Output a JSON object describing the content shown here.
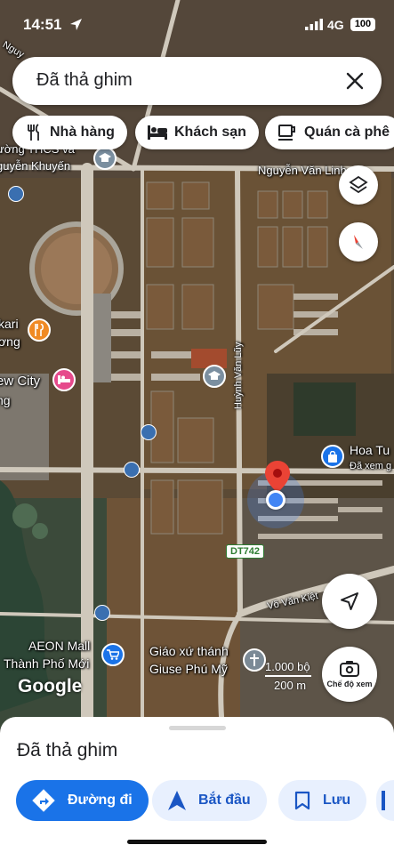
{
  "status_bar": {
    "time": "14:51",
    "network": "4G",
    "battery": "100"
  },
  "search": {
    "query": "Đã thả ghim"
  },
  "chips": [
    {
      "label": "Nhà hàng",
      "icon": "fork-knife-icon"
    },
    {
      "label": "Khách sạn",
      "icon": "bed-icon"
    },
    {
      "label": "Quán cà phê",
      "icon": "coffee-cup-icon"
    }
  ],
  "map_labels": {
    "school_1": "ường THCS và",
    "school_2": "guyễn Khuyến",
    "road_nguyen_van_linh": "Nguyễn Văn Linh",
    "road_huynh_van_luy": "Huỳnh Văn Lũy",
    "poi_karaoke_1": "kari",
    "poi_karaoke_2": "ơng",
    "poi_newcity": "ew City",
    "poi_ng": "ng",
    "hoa_tu": "Hoa Tu",
    "hoa_tu_sub": "Đã xem g",
    "road_dt742": "DT742",
    "road_vo_van_kiet": "Võ Văn Kiệt",
    "aeon_1": "AEON Mall",
    "aeon_2": "Thành Phố Mới",
    "church_1": "Giáo xứ thánh",
    "church_2": "Giuse Phú Mỹ",
    "nguy": "Nguy",
    "google": "Google",
    "scale_ft": "1.000 bộ",
    "scale_m": "200 m",
    "view_mode": "Chế độ xem"
  },
  "sheet": {
    "title": "Đã thả ghim",
    "actions": [
      {
        "label": "Đường đi",
        "icon": "directions-icon"
      },
      {
        "label": "Bắt đầu",
        "icon": "navigation-arrow-icon"
      },
      {
        "label": "Lưu",
        "icon": "bookmark-icon"
      }
    ]
  },
  "colors": {
    "accent": "#1a73e8",
    "pin": "#ea4335",
    "location": "#4285f4"
  }
}
